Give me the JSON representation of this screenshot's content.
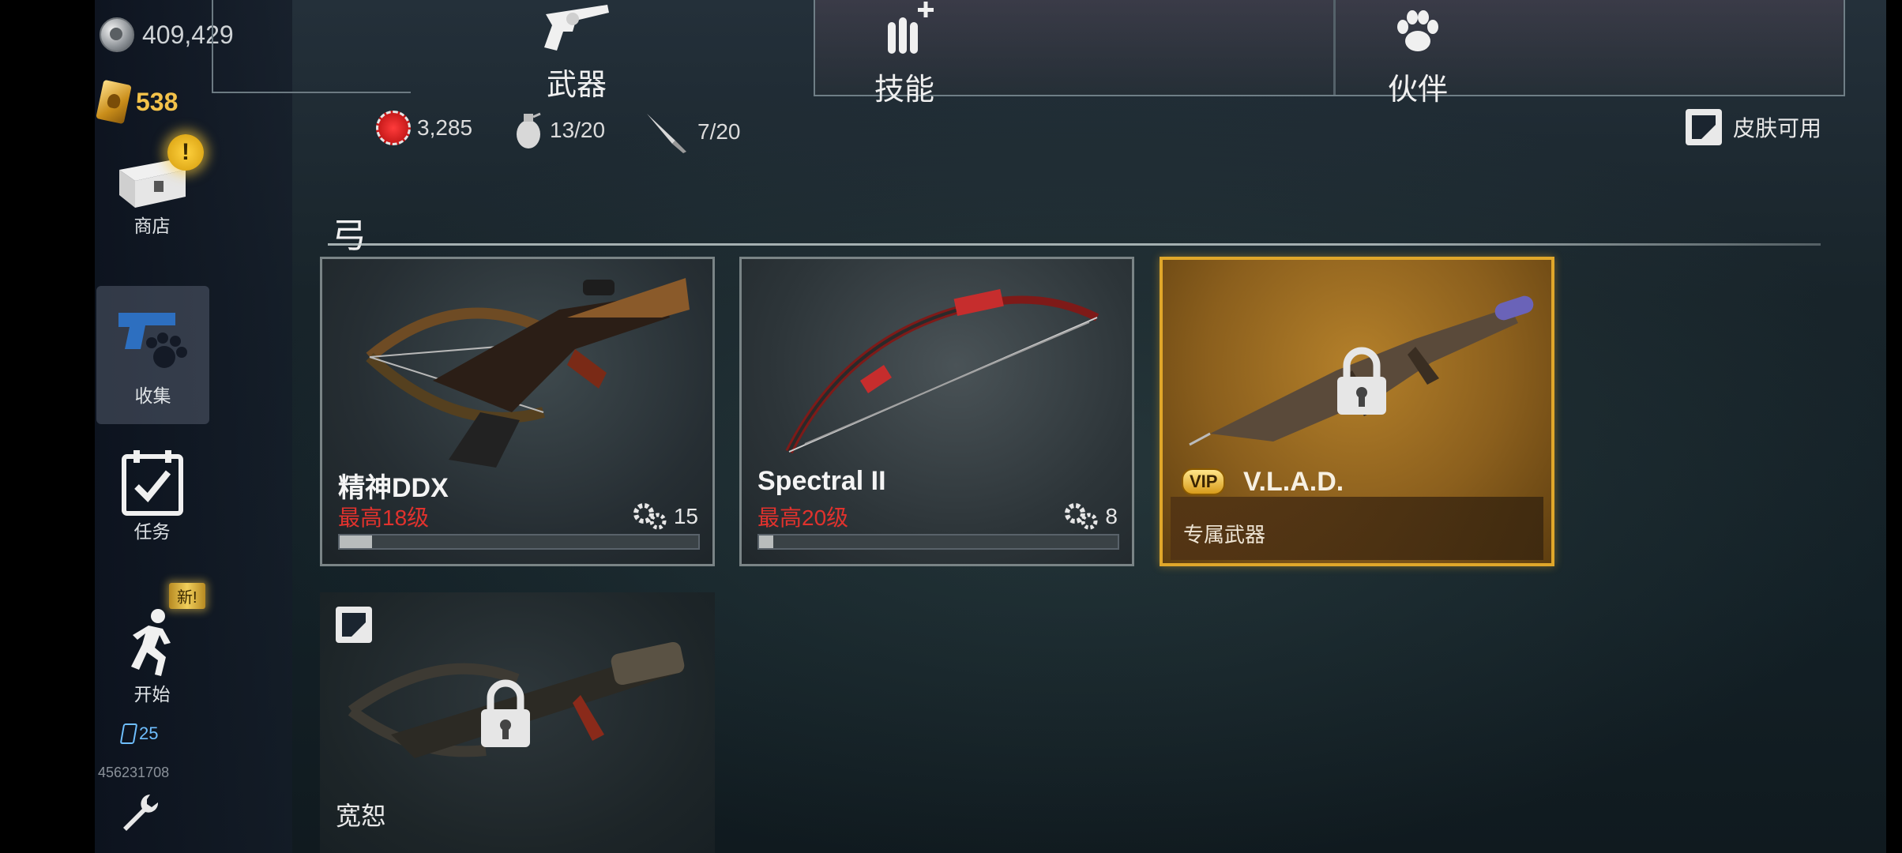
{
  "currency": {
    "silver": "409,429",
    "gold": "538"
  },
  "sidebar": {
    "alert_badge": "!",
    "items": [
      {
        "label": "商店"
      },
      {
        "label": "收集"
      },
      {
        "label": "任务"
      },
      {
        "label": "开始"
      }
    ],
    "new_badge": "新!",
    "tickets": "25",
    "player_id": "456231708"
  },
  "tabs": [
    {
      "label": "武器"
    },
    {
      "label": "技能"
    },
    {
      "label": "伙伴"
    }
  ],
  "resources": {
    "badges": "3,285",
    "grenades": "13/20",
    "knives": "7/20"
  },
  "skin_available": "皮肤可用",
  "section": {
    "title": "弓"
  },
  "weapons": [
    {
      "name": "精神DDX",
      "max_level": "最高18级",
      "parts": "15",
      "progress": 0.09
    },
    {
      "name": "Spectral II",
      "max_level": "最高20级",
      "parts": "8",
      "progress": 0.04
    },
    {
      "vip": "VIP",
      "name": "V.L.A.D.",
      "subtitle": "专属武器"
    },
    {
      "name": "宽恕"
    }
  ],
  "colors": {
    "gold": "#f3c24a",
    "level_red": "#e0322d",
    "vip_border": "#e0a72a"
  }
}
